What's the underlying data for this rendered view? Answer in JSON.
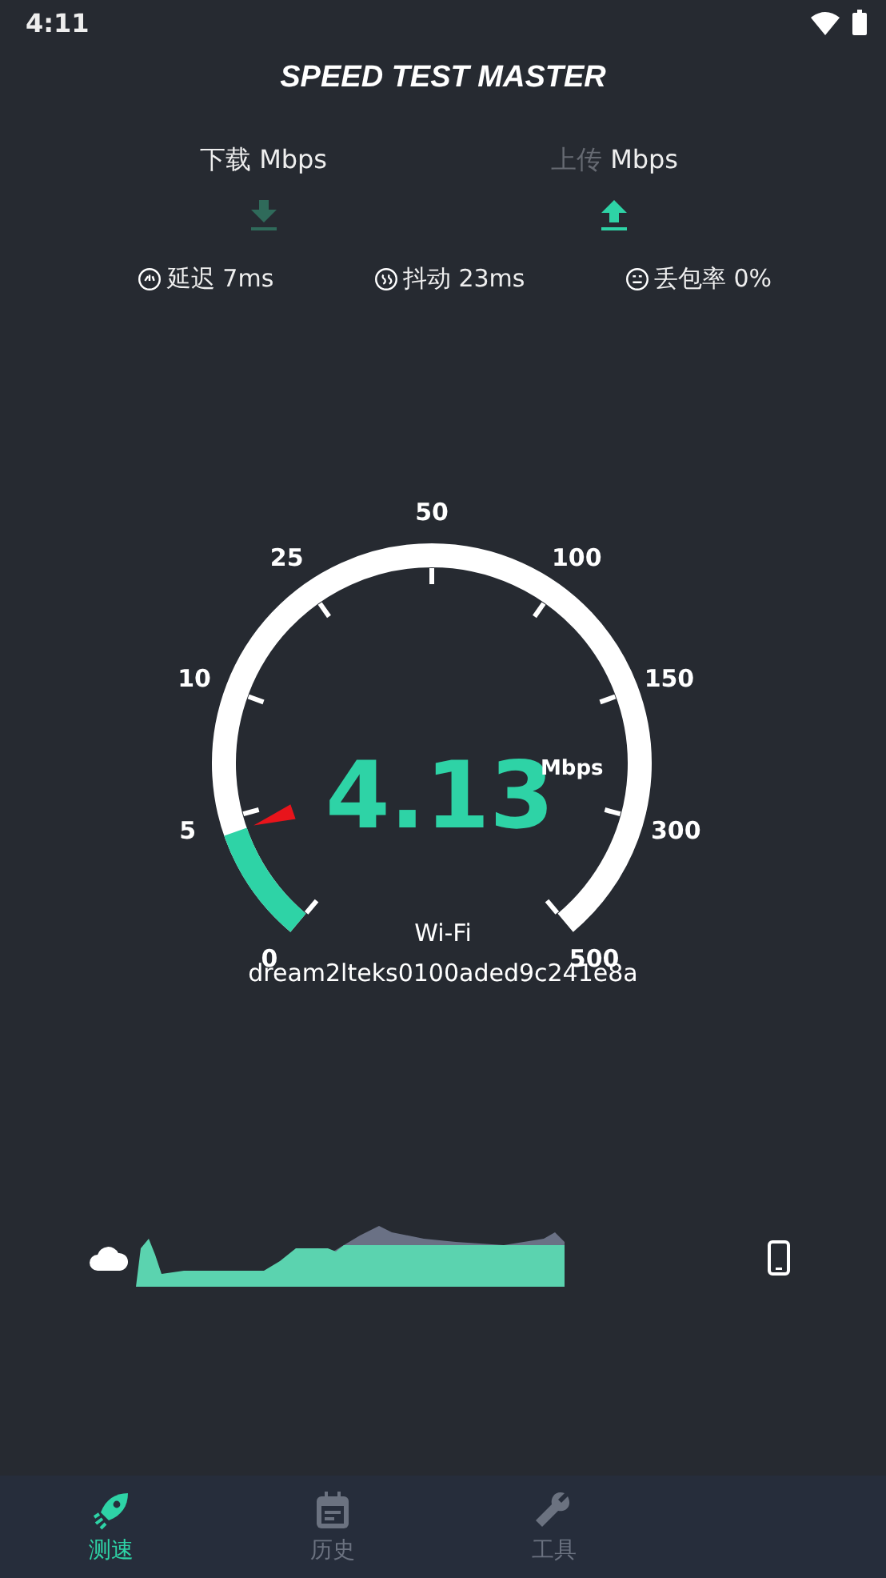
{
  "status_bar": {
    "time": "4:11"
  },
  "logo": "SPEED TEST MASTER",
  "directions": [
    {
      "kind": "download",
      "label": "下载",
      "unit": "Mbps",
      "label_dim": false,
      "icon_active": false
    },
    {
      "kind": "upload",
      "label": "上传",
      "unit": "Mbps",
      "label_dim": true,
      "icon_active": true
    }
  ],
  "metrics": [
    {
      "kind": "latency",
      "label": "延迟 7ms"
    },
    {
      "kind": "jitter",
      "label": "抖动 23ms"
    },
    {
      "kind": "loss",
      "label": "丢包率 0%"
    }
  ],
  "gauge": {
    "ticks": [
      "0",
      "5",
      "10",
      "25",
      "50",
      "100",
      "150",
      "300",
      "500"
    ],
    "value": "4.13",
    "unit": "Mbps",
    "connection": "Wi-Fi",
    "network": "dream2lteks0100aded9c241e8a"
  },
  "nav": [
    {
      "kind": "speed",
      "label": "测速",
      "selected": true
    },
    {
      "kind": "history",
      "label": "历史",
      "selected": false
    },
    {
      "kind": "tools",
      "label": "工具",
      "selected": false
    }
  ]
}
